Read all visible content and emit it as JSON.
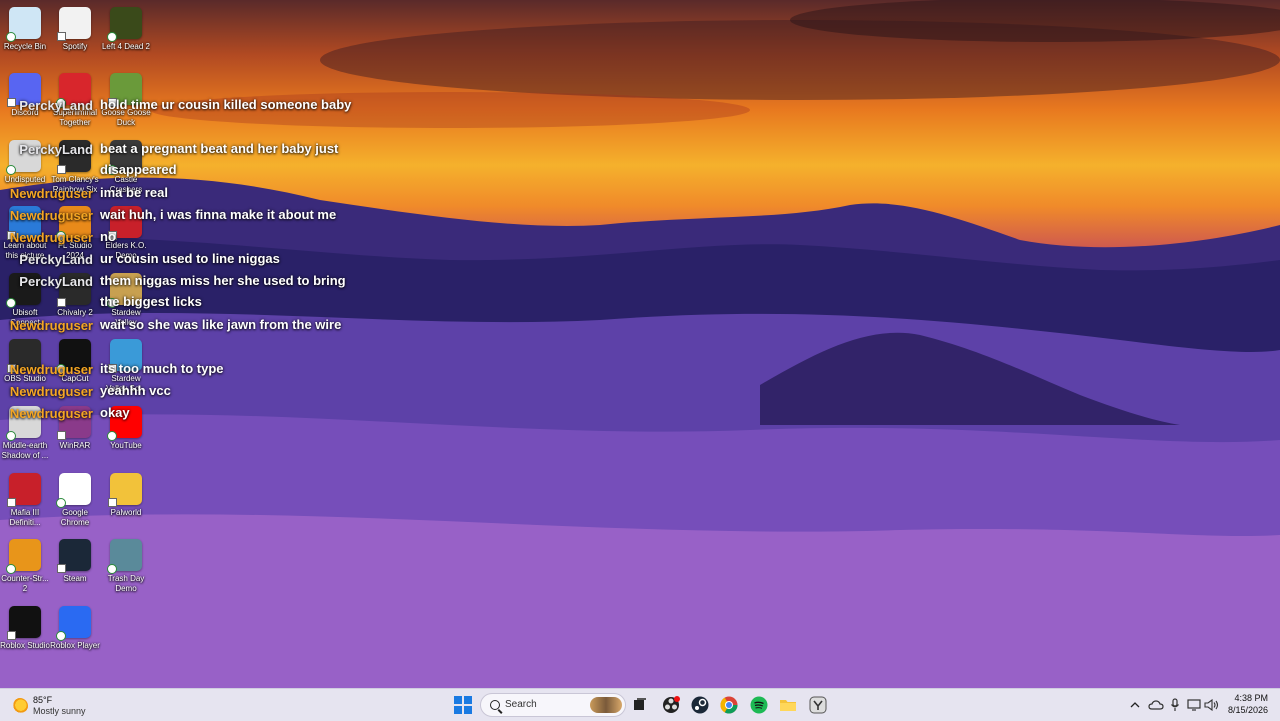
{
  "desktop": {
    "icons": [
      {
        "label": "Recycle Bin",
        "icon": "recycle-bin-icon",
        "color": "#cfe6f5"
      },
      {
        "label": "Spotify",
        "icon": "spotify-icon",
        "color": "#f2f2f2"
      },
      {
        "label": "Left 4 Dead 2",
        "icon": "left4dead2-icon",
        "color": "#3a4a1a"
      },
      {
        "label": "Discord",
        "icon": "discord-icon",
        "color": "#5865f2"
      },
      {
        "label": "Superliminal Together",
        "icon": "superliminal-icon",
        "color": "#d8262c"
      },
      {
        "label": "Goose Goose Duck",
        "icon": "goose-icon",
        "color": "#6a9a3a"
      },
      {
        "label": "Undisputed",
        "icon": "undisputed-icon",
        "color": "#d8d8d8"
      },
      {
        "label": "Tom Clancy's Rainbow Six",
        "icon": "rainbow-six-icon",
        "color": "#2a2a2a"
      },
      {
        "label": "Castle Crashers",
        "icon": "castle-crashers-icon",
        "color": "#3a3a3a"
      },
      {
        "label": "Learn about this picture",
        "icon": "learn-picture-icon",
        "color": "#2a7ad8"
      },
      {
        "label": "FL Studio 2024",
        "icon": "fl-studio-icon",
        "color": "#e88a1a"
      },
      {
        "label": "Elders K.O. Demo",
        "icon": "elders-ko-icon",
        "color": "#c8202a"
      },
      {
        "label": "Ubisoft Connect",
        "icon": "ubisoft-icon",
        "color": "#1a1a1a"
      },
      {
        "label": "Chivalry 2",
        "icon": "chivalry-icon",
        "color": "#2a2a2a"
      },
      {
        "label": "Stardew Valley",
        "icon": "stardew-icon",
        "color": "#c8a050"
      },
      {
        "label": "OBS Studio",
        "icon": "obs-icon",
        "color": "#2a2a2a"
      },
      {
        "label": "CapCut",
        "icon": "capcut-icon",
        "color": "#111111"
      },
      {
        "label": "Stardew Valley So...",
        "icon": "stardew-so-icon",
        "color": "#3a9ad8"
      },
      {
        "label": "Middle-earth Shadow of ...",
        "icon": "middle-earth-icon",
        "color": "#d8d8d8"
      },
      {
        "label": "WinRAR",
        "icon": "winrar-icon",
        "color": "#8a3a8a"
      },
      {
        "label": "YouTube",
        "icon": "youtube-icon",
        "color": "#ff0000"
      },
      {
        "label": "Mafia III Definiti...",
        "icon": "mafia-icon",
        "color": "#c8202a"
      },
      {
        "label": "Google Chrome",
        "icon": "chrome-icon",
        "color": "#ffffff"
      },
      {
        "label": "Palworld",
        "icon": "palworld-icon",
        "color": "#f2c23a"
      },
      {
        "label": "Counter-Str... 2",
        "icon": "counter-strike-icon",
        "color": "#e8951a"
      },
      {
        "label": "Steam",
        "icon": "steam-icon",
        "color": "#1b2838"
      },
      {
        "label": "Trash Day Demo",
        "icon": "trash-day-icon",
        "color": "#5a8a9a"
      },
      {
        "label": "Roblox Studio",
        "icon": "roblox-studio-icon",
        "color": "#111111"
      },
      {
        "label": "Roblox Player",
        "icon": "roblox-player-icon",
        "color": "#2a6af2"
      }
    ]
  },
  "chat": {
    "messages": [
      {
        "user": "PerckyLand",
        "text": "hold time ur cousin killed someone baby"
      },
      {
        "user": "PerckyLand",
        "text": "beat a pregnant beat and her baby just disappeared"
      },
      {
        "user": "Newdruguser",
        "text": "ima be real"
      },
      {
        "user": "Newdruguser",
        "text": "wait huh, i was finna make it about me"
      },
      {
        "user": "Newdruguser",
        "text": "no"
      },
      {
        "user": "PerckyLand",
        "text": "ur cousin used to line niggas"
      },
      {
        "user": "PerckyLand",
        "text": "them niggas miss her she used to bring the biggest licks"
      },
      {
        "user": "Newdruguser",
        "text": "wait so she was like jawn from the wire"
      },
      {
        "user": "Newdruguser",
        "text": "its too much to type"
      },
      {
        "user": "Newdruguser",
        "text": "yeahhh vcc"
      },
      {
        "user": "Newdruguser",
        "text": "okay"
      }
    ]
  },
  "taskbar": {
    "weather": {
      "temp": "85°F",
      "condition": "Mostly sunny"
    },
    "search_placeholder": "Search",
    "clock": {
      "time": "4:38 PM",
      "date": "8/15/2026"
    }
  }
}
